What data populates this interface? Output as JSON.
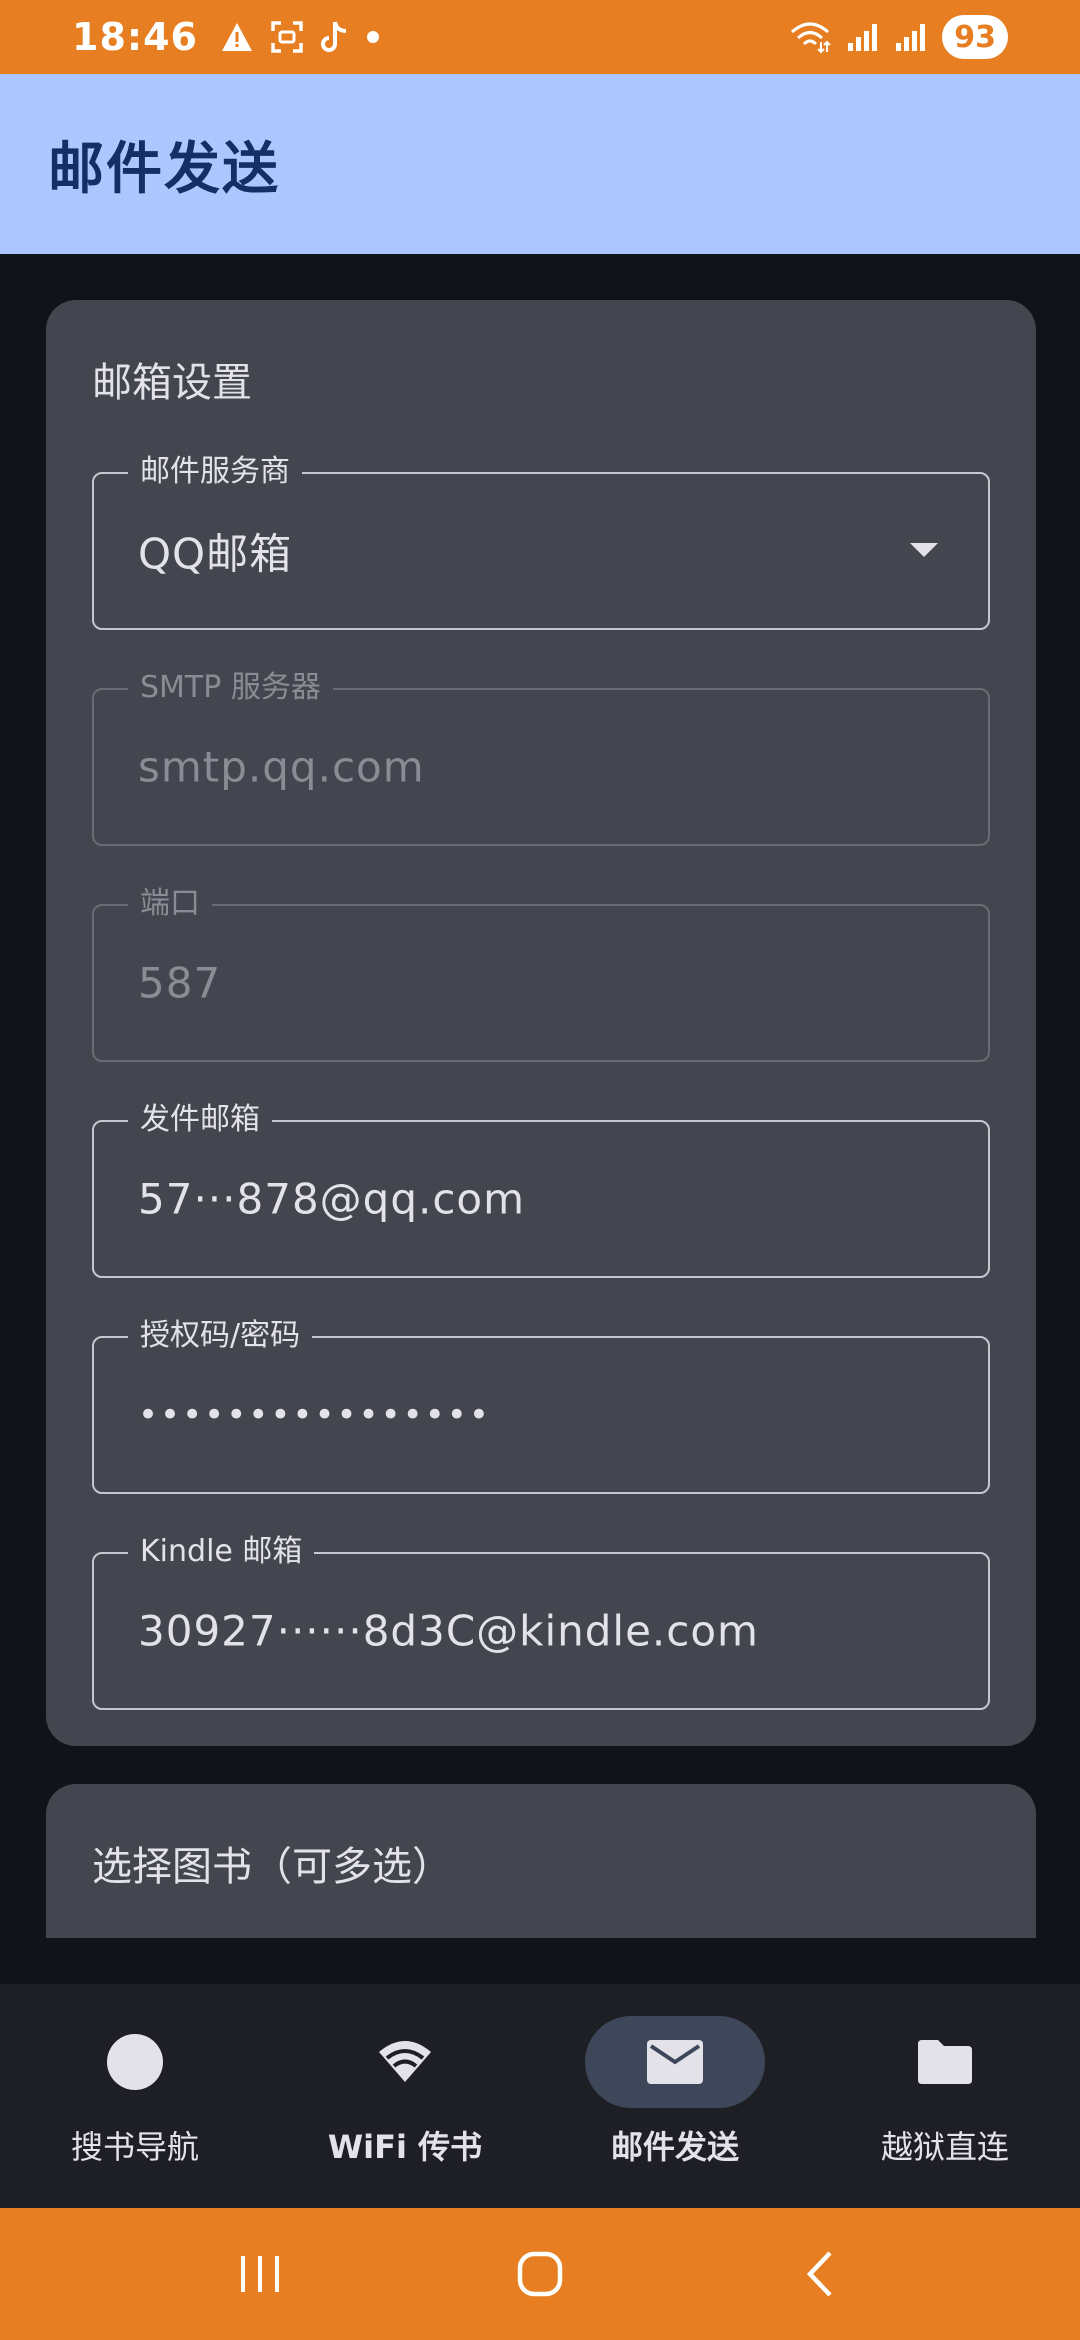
{
  "status_bar": {
    "time": "18:46",
    "battery": "93",
    "left_icons": [
      "warning-icon",
      "screenshot-icon",
      "tiktok-icon",
      "dot-icon"
    ],
    "right_icons": [
      "wifi-icon",
      "signal-icon",
      "signal-icon"
    ],
    "color": "#E77F22"
  },
  "app_bar": {
    "title": "邮件发送",
    "color": "#AEC6FF"
  },
  "settings_card": {
    "title": "邮箱设置",
    "provider": {
      "label": "邮件服务商",
      "value": "QQ邮箱"
    },
    "smtp": {
      "label": "SMTP 服务器",
      "value": "smtp.qq.com"
    },
    "port": {
      "label": "端口",
      "value": "587"
    },
    "sender": {
      "label": "发件邮箱",
      "value": "57···878@qq.com"
    },
    "password": {
      "label": "授权码/密码",
      "value": "••••••••••••••••"
    },
    "kindle": {
      "label": "Kindle 邮箱",
      "value": "30927······8d3C@kindle.com"
    }
  },
  "books_card": {
    "title": "选择图书（可多选）"
  },
  "bottom_nav": {
    "items": [
      {
        "label": "搜书导航",
        "icon": "circle-icon",
        "active": false
      },
      {
        "label": "WiFi 传书",
        "icon": "wifi-icon",
        "active": false
      },
      {
        "label": "邮件发送",
        "icon": "mail-icon",
        "active": true
      },
      {
        "label": "越狱直连",
        "icon": "folder-icon",
        "active": false
      }
    ]
  },
  "system_nav": {
    "icons": [
      "recents-icon",
      "home-icon",
      "back-icon"
    ]
  }
}
